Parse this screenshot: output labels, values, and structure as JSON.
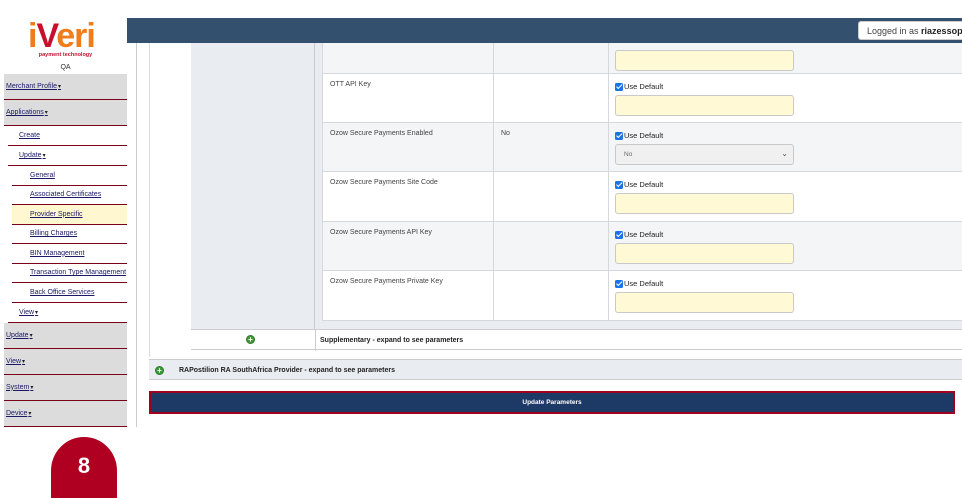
{
  "brand": {
    "logo_text_i": "i",
    "logo_text_v": "V",
    "logo_text_eri": "eri",
    "tagline": "payment technology",
    "environment": "QA"
  },
  "colors": {
    "topbar": "#33506f",
    "accent_red": "#a0001c",
    "brand_orange": "#f07c1b",
    "input_yellow": "#fff9d6"
  },
  "topbar": {
    "logged_in_prefix": "Logged in as ",
    "logged_in_user": "riazessop"
  },
  "sidebar": {
    "items": [
      {
        "label": "Merchant Profile",
        "level": 0,
        "caret": "▾"
      },
      {
        "label": "Applications",
        "level": 0,
        "caret": "▾"
      },
      {
        "label": "Create",
        "level": 1
      },
      {
        "label": "Update",
        "level": 1,
        "caret": "▾"
      },
      {
        "label": "General",
        "level": 2
      },
      {
        "label": "Associated Certificates",
        "level": 2
      },
      {
        "label": "Provider Specific",
        "level": 2,
        "active": true
      },
      {
        "label": "Billing Charges",
        "level": 2
      },
      {
        "label": "BIN Management",
        "level": 2
      },
      {
        "label": "Transaction Type Management",
        "level": 2
      },
      {
        "label": "Back Office Services",
        "level": 2
      },
      {
        "label": "View",
        "level": 1,
        "caret": "▾"
      },
      {
        "label": "Update",
        "level": 0,
        "caret": "▾"
      },
      {
        "label": "View",
        "level": 0,
        "caret": "▾"
      },
      {
        "label": "System",
        "level": 0,
        "caret": "▾"
      },
      {
        "label": "Device",
        "level": 0,
        "caret": "▾"
      }
    ]
  },
  "parameters": {
    "use_default_label": "Use Default",
    "rows": [
      {
        "name": "",
        "value": "",
        "control": "input",
        "show_checkbox": false
      },
      {
        "name": "OTT API Key",
        "value": "",
        "control": "input",
        "show_checkbox": true
      },
      {
        "name": "Ozow Secure Payments Enabled",
        "value": "No",
        "control": "select",
        "select_value": "No",
        "show_checkbox": true
      },
      {
        "name": "Ozow Secure Payments Site Code",
        "value": "",
        "control": "input",
        "show_checkbox": true
      },
      {
        "name": "Ozow Secure Payments API Key",
        "value": "",
        "control": "input",
        "show_checkbox": true
      },
      {
        "name": "Ozow Secure Payments Private Key",
        "value": "",
        "control": "input",
        "show_checkbox": true
      }
    ]
  },
  "supplementary": {
    "label": "Supplementary - expand to see parameters",
    "icon": "plus-circle-icon"
  },
  "rapostilion": {
    "label": "RAPostilion RA SouthAfrica Provider - expand to see parameters",
    "icon": "plus-circle-icon"
  },
  "actions": {
    "update_label": "Update Parameters"
  },
  "step": {
    "number": "8"
  }
}
